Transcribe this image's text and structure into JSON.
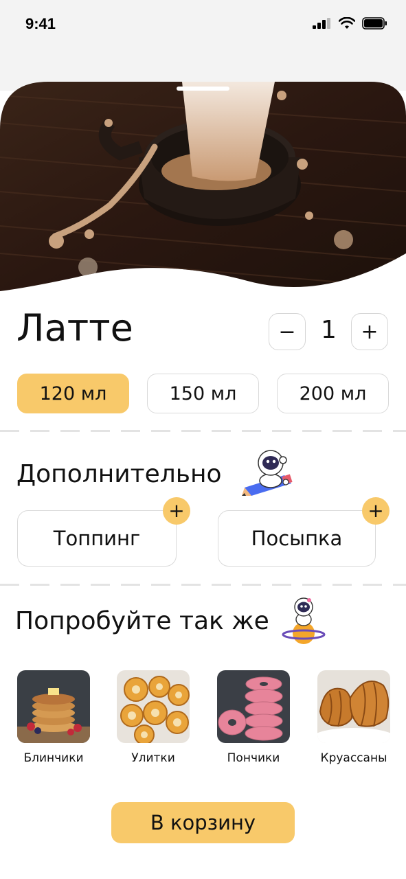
{
  "status_bar": {
    "time": "9:41"
  },
  "product": {
    "name": "Латте",
    "quantity": "1",
    "minus_label": "−",
    "plus_label": "+"
  },
  "sizes": [
    {
      "label": "120 мл",
      "selected": true
    },
    {
      "label": "150 мл",
      "selected": false
    },
    {
      "label": "200 мл",
      "selected": false
    }
  ],
  "extras": {
    "title": "Дополнительно",
    "items": [
      {
        "label": "Топпинг",
        "add_label": "+"
      },
      {
        "label": "Посыпка",
        "add_label": "+"
      }
    ]
  },
  "recommendations": {
    "title": "Попробуйте так же",
    "items": [
      {
        "label": "Блинчики",
        "icon": "pancakes-image"
      },
      {
        "label": "Улитки",
        "icon": "snail-pastries-image"
      },
      {
        "label": "Пончики",
        "icon": "donuts-image"
      },
      {
        "label": "Круассаны",
        "icon": "croissants-image"
      }
    ]
  },
  "cart_button": {
    "label": "В корзину"
  },
  "colors": {
    "accent": "#f8c96a",
    "border": "#d9d9d9",
    "divider": "#e3e3e3",
    "text": "#111111",
    "status_bg": "#f3f3f3"
  }
}
